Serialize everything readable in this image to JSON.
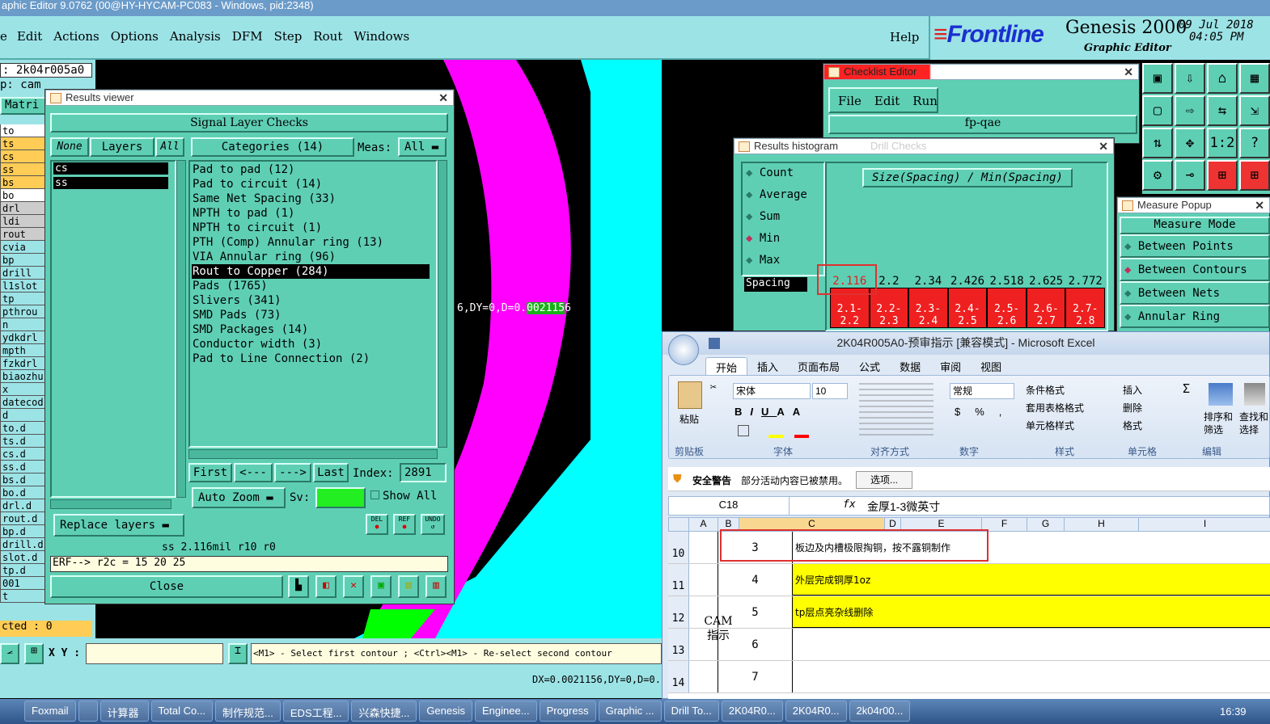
{
  "titlebar": {
    "text": "aphic Editor 9.0762 (00@HY-HYCAM-PC083 - Windows, pid:2348)"
  },
  "menu": {
    "items": [
      "e",
      "Edit",
      "Actions",
      "Options",
      "Analysis",
      "DFM",
      "Step",
      "Rout",
      "Windows"
    ],
    "help": "Help"
  },
  "brand": {
    "logo": "Frontline",
    "product": "Genesis 2000",
    "sub": "Graphic Editor",
    "date": "09 Jul 2018",
    "time": "04:05 PM"
  },
  "left_panel": {
    "job": ": 2k04r005a0",
    "step": "p: cam",
    "matrix": "Matri",
    "layers": [
      "to",
      "ts",
      "cs",
      "ss",
      "bs",
      "bo",
      "drl",
      "ldi",
      "rout",
      "cvia",
      "bp",
      "drill",
      "l1slot",
      "tp",
      "pthrou",
      "n",
      "ydkdrl",
      "mpth",
      "fzkdrl",
      "biaozhu",
      "x",
      "datecod",
      "d",
      "to.d",
      "ts.d",
      "cs.d",
      "ss.d",
      "bs.d",
      "bo.d",
      "drl.d",
      "rout.d",
      "bp.d",
      "drill.d",
      "slot.d",
      "tp.d",
      "001",
      "t"
    ],
    "selected": "cted : 0"
  },
  "results_viewer": {
    "title": "Results viewer",
    "header": "Signal Layer Checks",
    "none": "None",
    "layers": "Layers",
    "all": "All",
    "categories": "Categories (14)",
    "meas_label": "Meas:",
    "meas_value": "All",
    "layer_list": [
      "cs",
      "ss"
    ],
    "category_list": [
      "Pad to pad (12)",
      "Pad to circuit (14)",
      "Same Net Spacing (33)",
      "NPTH to pad (1)",
      "NPTH to circuit (1)",
      "PTH (Comp) Annular ring (13)",
      "VIA Annular ring (96)",
      "Rout to Copper (284)",
      "Pads (1765)",
      "Slivers (341)",
      "SMD Pads (73)",
      "SMD Packages (14)",
      "Conductor width (3)",
      "Pad to Line Connection (2)"
    ],
    "first": "First",
    "prev": "<---",
    "next": "--->",
    "last": "Last",
    "index_label": "Index:",
    "index_value": "2891",
    "auto_zoom": "Auto Zoom",
    "sv": "Sv:",
    "show_all": "Show All",
    "replace_layers": "Replace layers",
    "del": "DEL",
    "ref": "REF",
    "undo": "UNDO",
    "status": "ss 2.116mil  r10  r0",
    "erf": "ERF--> r2c = 15 20 25",
    "close": "Close"
  },
  "canvas": {
    "measure_text": "6,DY=0,D=0.",
    "measure_hl": "002115",
    "measure_end": "6"
  },
  "checklist": {
    "title": "Checklist Editor",
    "menu": [
      "File",
      "Edit",
      "Run"
    ],
    "name": "fp-qae"
  },
  "histogram": {
    "title": "Results histogram",
    "faded": "Drill Checks",
    "options": [
      "Count",
      "Average",
      "Sum",
      "Min",
      "Max"
    ],
    "selected": "Min",
    "metric": "Size(Spacing) / Min(Spacing)",
    "field": "Spacing",
    "values": [
      "2.116",
      "2.2",
      "2.34",
      "2.426",
      "2.518",
      "2.625",
      "2.772"
    ],
    "bins": [
      [
        "2.1-",
        "2.2"
      ],
      [
        "2.2-",
        "2.3"
      ],
      [
        "2.3-",
        "2.4"
      ],
      [
        "2.4-",
        "2.5"
      ],
      [
        "2.5-",
        "2.6"
      ],
      [
        "2.6-",
        "2.7"
      ],
      [
        "2.7-",
        "2.8"
      ]
    ]
  },
  "measure_popup": {
    "title": "Measure Popup",
    "mode": "Measure Mode",
    "options": [
      "Between Points",
      "Between Contours",
      "Between Nets",
      "Annular Ring"
    ],
    "selected": "Between Contours"
  },
  "excel": {
    "title": "2K04R005A0-预审指示  [兼容模式] - Microsoft Excel",
    "tabs": [
      "开始",
      "插入",
      "页面布局",
      "公式",
      "数据",
      "审阅",
      "视图"
    ],
    "font": "宋体",
    "size": "10",
    "numfmt": "常规",
    "groups": [
      "剪贴板",
      "字体",
      "对齐方式",
      "数字",
      "样式",
      "单元格",
      "编辑"
    ],
    "paste": "粘贴",
    "styles": [
      "条件格式",
      "套用表格格式",
      "单元格样式"
    ],
    "cells_grp": [
      "插入",
      "删除",
      "格式"
    ],
    "edit_grp": [
      "排序和筛选",
      "查找和选择"
    ],
    "security_label": "安全警告",
    "security_text": "部分活动内容已被禁用。",
    "options_btn": "选项...",
    "cell_ref": "C18",
    "formula": "金厚1-3微英寸",
    "cols": [
      "A",
      "B",
      "C",
      "D",
      "E",
      "F",
      "G",
      "H",
      "I"
    ],
    "rows": [
      {
        "num": "10",
        "b": "3",
        "c": "板边及内槽极限掏铜，按不露铜制作",
        "hl": false
      },
      {
        "num": "11",
        "b": "4",
        "c": "外层完成铜厚1oz",
        "hl": true
      },
      {
        "num": "12",
        "b": "5",
        "c": "tp层点亮杂线删除",
        "hl": true
      },
      {
        "num": "13",
        "b": "6",
        "c": "",
        "hl": false
      },
      {
        "num": "14",
        "b": "7",
        "c": "",
        "hl": false
      }
    ],
    "cam_label": "CAM\n指示"
  },
  "bottom": {
    "xy": "X Y :",
    "prompt": "<M1> - Select first contour ; <Ctrl><M1> - Re-select second contour",
    "dx": "DX=0.0021156,DY=0,D=0."
  },
  "taskbar": {
    "items": [
      "Foxmail",
      "",
      "计算器",
      "Total Co...",
      "制作规范...",
      "EDS工程...",
      "兴森快捷...",
      "Genesis",
      "Enginee...",
      "Progress",
      "Graphic ...",
      "Drill To...",
      "2K04R0...",
      "2K04R0...",
      "2k04r00..."
    ],
    "clock": "16:39"
  },
  "colors": {
    "teal": "#5fcfb4",
    "magenta": "#ff00ff",
    "cyan": "#00ffff",
    "green": "#00ff00",
    "red": "#ff0000",
    "yellow": "#ffff00"
  }
}
